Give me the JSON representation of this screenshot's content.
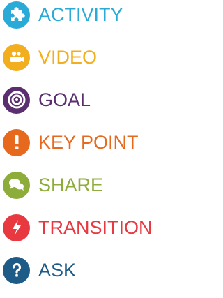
{
  "legend": {
    "items": [
      {
        "label": "ACTIVITY",
        "icon": "puzzle-icon",
        "color": "#2aaad6"
      },
      {
        "label": "VIDEO",
        "icon": "video-camera-icon",
        "color": "#f2ae1c"
      },
      {
        "label": "GOAL",
        "icon": "target-icon",
        "color": "#5a2e6f"
      },
      {
        "label": "KEY POINT",
        "icon": "exclamation-icon",
        "color": "#e6691e"
      },
      {
        "label": "SHARE",
        "icon": "speech-bubbles-icon",
        "color": "#8eac3a"
      },
      {
        "label": "TRANSITION",
        "icon": "lightning-bolt-icon",
        "color": "#e7393f"
      },
      {
        "label": "ASK",
        "icon": "question-mark-icon",
        "color": "#1e5b86"
      }
    ]
  }
}
